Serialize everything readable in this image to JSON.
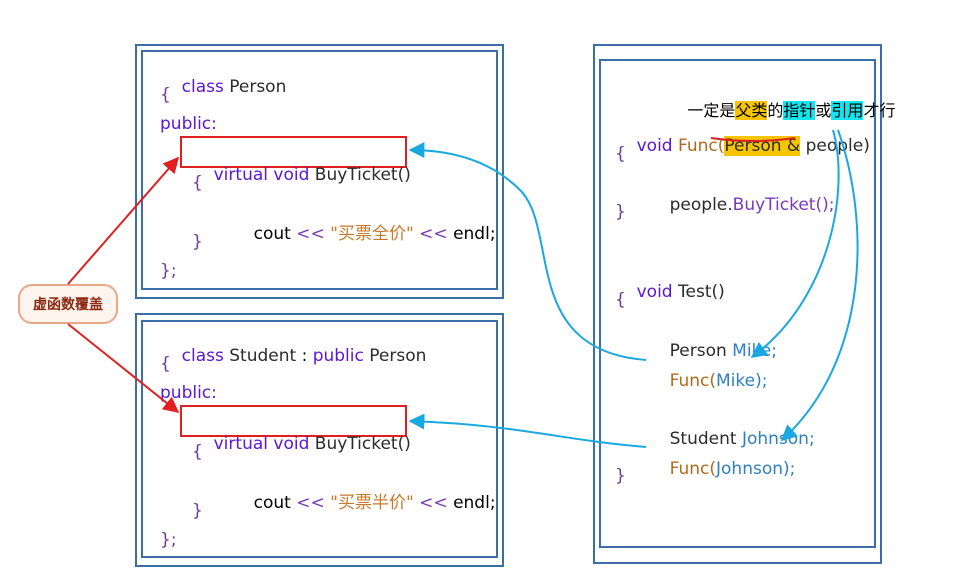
{
  "note": {
    "p1": "一定是",
    "p2": "父类",
    "p3": "的",
    "p4": "指针",
    "p5": "或",
    "p6": "引用",
    "p7": "才行"
  },
  "bubble_label": "虚函数覆盖",
  "person_class": {
    "kw_class": "class",
    "name": "Person",
    "open_brace": "{",
    "kw_public": "public:",
    "kw_virtual": "virtual",
    "kw_void": "void",
    "method": "BuyTicket()",
    "body_open": "{",
    "cout": "cout",
    "op1": "<<",
    "str": "\"买票全价\"",
    "op2": "<<",
    "endl": "endl;",
    "body_close": "}",
    "close": "};"
  },
  "student_class": {
    "kw_class": "class",
    "name": "Student",
    "colon": ":",
    "kw_public_inherit": "public",
    "base": "Person",
    "open_brace": "{",
    "kw_public": "public:",
    "kw_virtual": "virtual",
    "kw_void": "void",
    "method": "BuyTicket()",
    "body_open": "{",
    "cout": "cout",
    "op1": "<<",
    "str": "\"买票半价\"",
    "op2": "<<",
    "endl": "endl;",
    "body_close": "}",
    "close": "};"
  },
  "func_code": {
    "kw_void": "void",
    "func_name": "Func(",
    "param_type": "Person &",
    "param_name": "people)",
    "open_brace": "{",
    "call_obj": "people.",
    "call_method": "BuyTicket();",
    "close_brace": "}"
  },
  "test_code": {
    "kw_void": "void",
    "func_name": "Test()",
    "open_brace": "{",
    "decl1_type": "Person",
    "decl1_var": "Mike;",
    "call1_fn": "Func(",
    "call1_arg": "Mike);",
    "decl2_type": "Student",
    "decl2_var": "Johnson;",
    "call2_fn": "Func(",
    "call2_arg": "Johnson);",
    "close_brace": "}"
  },
  "colors": {
    "frame": "#3a6ea8",
    "red": "#e02020",
    "arrow_blue": "#1aa8e0",
    "highlight_yellow": "#f7c400",
    "highlight_cyan": "#10e6f0"
  }
}
